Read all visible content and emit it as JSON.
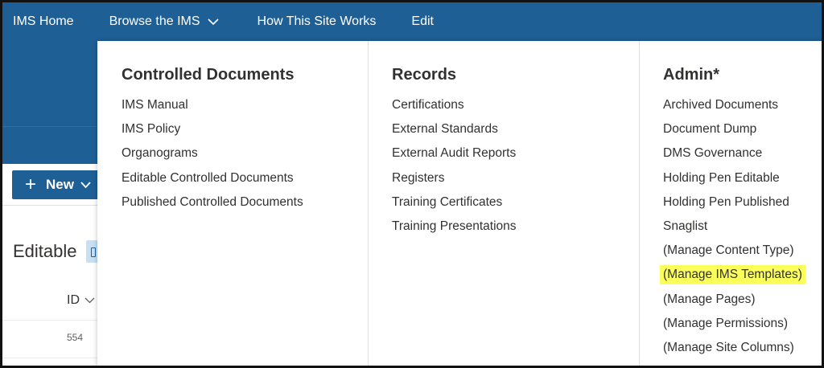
{
  "topnav": {
    "home": "IMS Home",
    "browse": "Browse the IMS",
    "how": "How This Site Works",
    "edit": "Edit",
    "icons": {
      "browse_chevron": "chevron-down-icon"
    }
  },
  "commandbar": {
    "new_label": "New",
    "icons": {
      "plus": "plus-icon",
      "chevron": "chevron-down-icon"
    }
  },
  "list": {
    "title": "Editable",
    "column_id": "ID",
    "rows": [
      {
        "id": "554"
      }
    ]
  },
  "menu": {
    "columns": [
      {
        "heading": "Controlled Documents",
        "items": [
          "IMS Manual",
          "IMS Policy",
          "Organograms",
          "Editable Controlled Documents",
          "Published Controlled Documents"
        ]
      },
      {
        "heading": "Records",
        "items": [
          "Certifications",
          "External Standards",
          "External Audit Reports",
          "Registers",
          "Training Certificates",
          "Training Presentations"
        ]
      },
      {
        "heading": "Admin*",
        "items": [
          "Archived Documents",
          "Document Dump",
          "DMS Governance",
          "Holding Pen Editable",
          "Holding Pen Published",
          "Snaglist",
          "(Manage Content Type)",
          "(Manage IMS Templates)",
          "(Manage Pages)",
          "(Manage Permissions)",
          "(Manage Site Columns)"
        ]
      }
    ],
    "highlighted_item": "(Manage IMS Templates)"
  },
  "colors": {
    "brand": "#1e5f96",
    "highlight": "#fbff5c",
    "text": "#323130"
  }
}
